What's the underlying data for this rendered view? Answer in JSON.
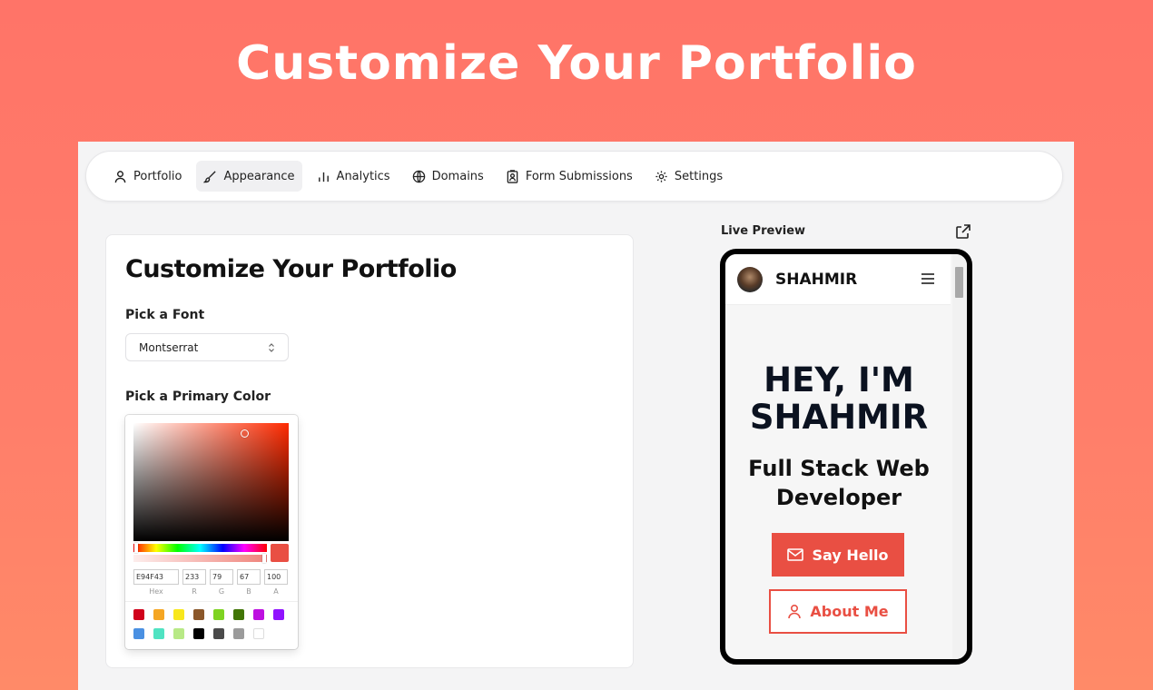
{
  "hero": {
    "title": "Customize Your Portfolio"
  },
  "nav": {
    "items": [
      {
        "label": "Portfolio",
        "icon": "user-icon"
      },
      {
        "label": "Appearance",
        "icon": "brush-icon",
        "active": true
      },
      {
        "label": "Analytics",
        "icon": "bar-chart-icon"
      },
      {
        "label": "Domains",
        "icon": "globe-icon"
      },
      {
        "label": "Form Submissions",
        "icon": "form-icon"
      },
      {
        "label": "Settings",
        "icon": "gear-icon"
      }
    ]
  },
  "editor": {
    "title": "Customize Your Portfolio",
    "font_label": "Pick a Font",
    "font_value": "Montserrat",
    "color_label": "Pick a Primary Color",
    "picker": {
      "hex": "E94F43",
      "r": "233",
      "g": "79",
      "b": "67",
      "a": "100",
      "hex_label": "Hex",
      "r_label": "R",
      "g_label": "G",
      "b_label": "B",
      "a_label": "A",
      "selected_color": "#e94f43",
      "presets": [
        "#d0021b",
        "#f5a623",
        "#f8e71c",
        "#8b572a",
        "#7ed321",
        "#417505",
        "#bd10e0",
        "#9013fe",
        "#4a90e2",
        "#50e3c2",
        "#b8e986",
        "#000000",
        "#4a4a4a",
        "#9b9b9b",
        "#ffffff"
      ]
    }
  },
  "preview": {
    "label": "Live Preview",
    "site_name": "SHAHMIR",
    "headline_line1": "HEY, I'M",
    "headline_line2": "SHAHMIR",
    "subtitle_line1": "Full Stack Web",
    "subtitle_line2": "Developer",
    "primary_button": "Say Hello",
    "secondary_button": "About Me"
  }
}
